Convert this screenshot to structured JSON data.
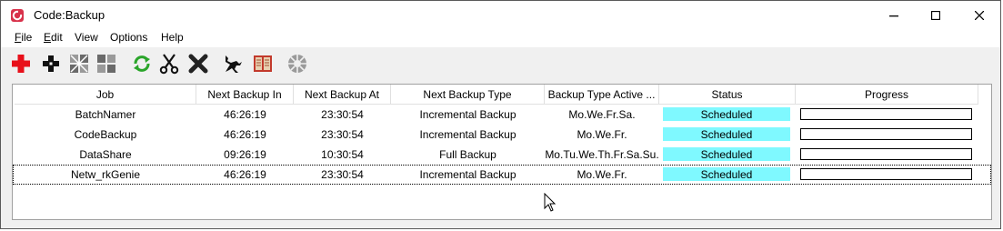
{
  "window": {
    "title": "Code:Backup"
  },
  "menu": [
    {
      "label": "File",
      "mnemonic": "F",
      "rest": "ile"
    },
    {
      "label": "Edit",
      "mnemonic": "E",
      "rest": "dit"
    },
    {
      "label": "View",
      "mnemonic": "",
      "rest": "View"
    },
    {
      "label": "Options",
      "mnemonic": "",
      "rest": "Options"
    },
    {
      "label": "Help",
      "mnemonic": "",
      "rest": "Help"
    }
  ],
  "toolbar": [
    {
      "icon": "add-icon"
    },
    {
      "icon": "edit-icon"
    },
    {
      "icon": "collapse-icon"
    },
    {
      "icon": "expand-icon"
    },
    {
      "icon": "refresh-icon"
    },
    {
      "icon": "cut-icon"
    },
    {
      "icon": "delete-icon"
    },
    {
      "icon": "run-icon"
    },
    {
      "icon": "log-book-icon"
    },
    {
      "icon": "settings-wheel-icon"
    }
  ],
  "table": {
    "columns": [
      "Job",
      "Next Backup In",
      "Next Backup At",
      "Next Backup Type",
      "Backup Type Active ...",
      "Status",
      "Progress"
    ],
    "rows": [
      {
        "job": "BatchNamer",
        "in": "46:26:19",
        "at": "23:30:54",
        "type": "Incremental Backup",
        "active": "Mo.We.Fr.Sa.",
        "status": "Scheduled",
        "progress": 0
      },
      {
        "job": "CodeBackup",
        "in": "46:26:19",
        "at": "23:30:54",
        "type": "Incremental Backup",
        "active": "Mo.We.Fr.",
        "status": "Scheduled",
        "progress": 0
      },
      {
        "job": "DataShare",
        "in": "09:26:19",
        "at": "10:30:54",
        "type": "Full Backup",
        "active": "Mo.Tu.We.Th.Fr.Sa.Su.",
        "status": "Scheduled",
        "progress": 0
      },
      {
        "job": "Netw_rkGenie",
        "in": "46:26:19",
        "at": "23:30:54",
        "type": "Incremental Backup",
        "active": "Mo.We.Fr.",
        "status": "Scheduled",
        "progress": 0
      }
    ]
  },
  "colors": {
    "status_bg": "#7ff9ff"
  }
}
